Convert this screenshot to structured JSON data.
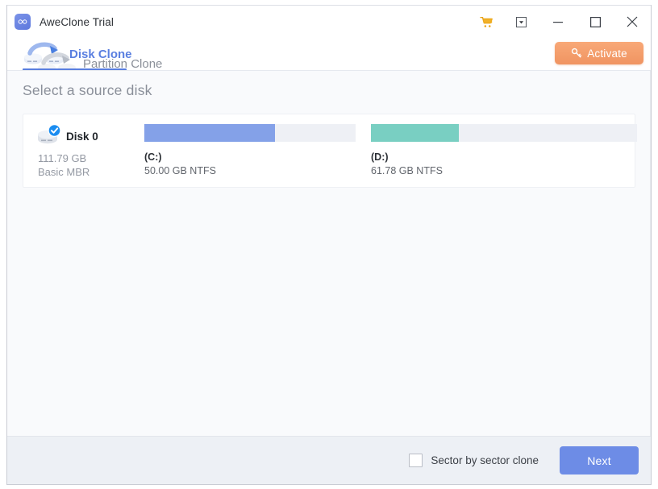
{
  "window": {
    "title": "AweClone Trial",
    "logo_icon": "infinity-icon",
    "controls": {
      "cart": "cart-icon",
      "tray": "minimize-to-tray-icon",
      "minimize": "minimize-icon",
      "maximize": "maximize-icon",
      "close": "close-icon"
    }
  },
  "tabs": [
    {
      "label": "Disk Clone",
      "icon": "disk-clone-icon",
      "active": true
    },
    {
      "label": "Partition Clone",
      "icon": "partition-clone-icon",
      "active": false
    }
  ],
  "activate": {
    "label": "Activate",
    "icon": "key-icon",
    "color": "#f4a072"
  },
  "main": {
    "page_title": "Select a source disk",
    "disks": [
      {
        "name": "Disk 0",
        "capacity": "111.79 GB",
        "scheme": "Basic MBR",
        "selected": true,
        "icon": "disk-icon",
        "badge_icon": "check-badge-icon",
        "partitions": [
          {
            "label": "(C:)",
            "size": "50.00 GB NTFS",
            "used_percent": 62,
            "color": "#84a1e8"
          },
          {
            "label": "(D:)",
            "size": "61.78 GB NTFS",
            "used_percent": 33,
            "color": "#79cfc2"
          }
        ]
      }
    ]
  },
  "footer": {
    "sector_checkbox_label": "Sector by sector clone",
    "sector_checkbox_checked": false,
    "next_label": "Next",
    "next_color": "#6d8ce6"
  }
}
